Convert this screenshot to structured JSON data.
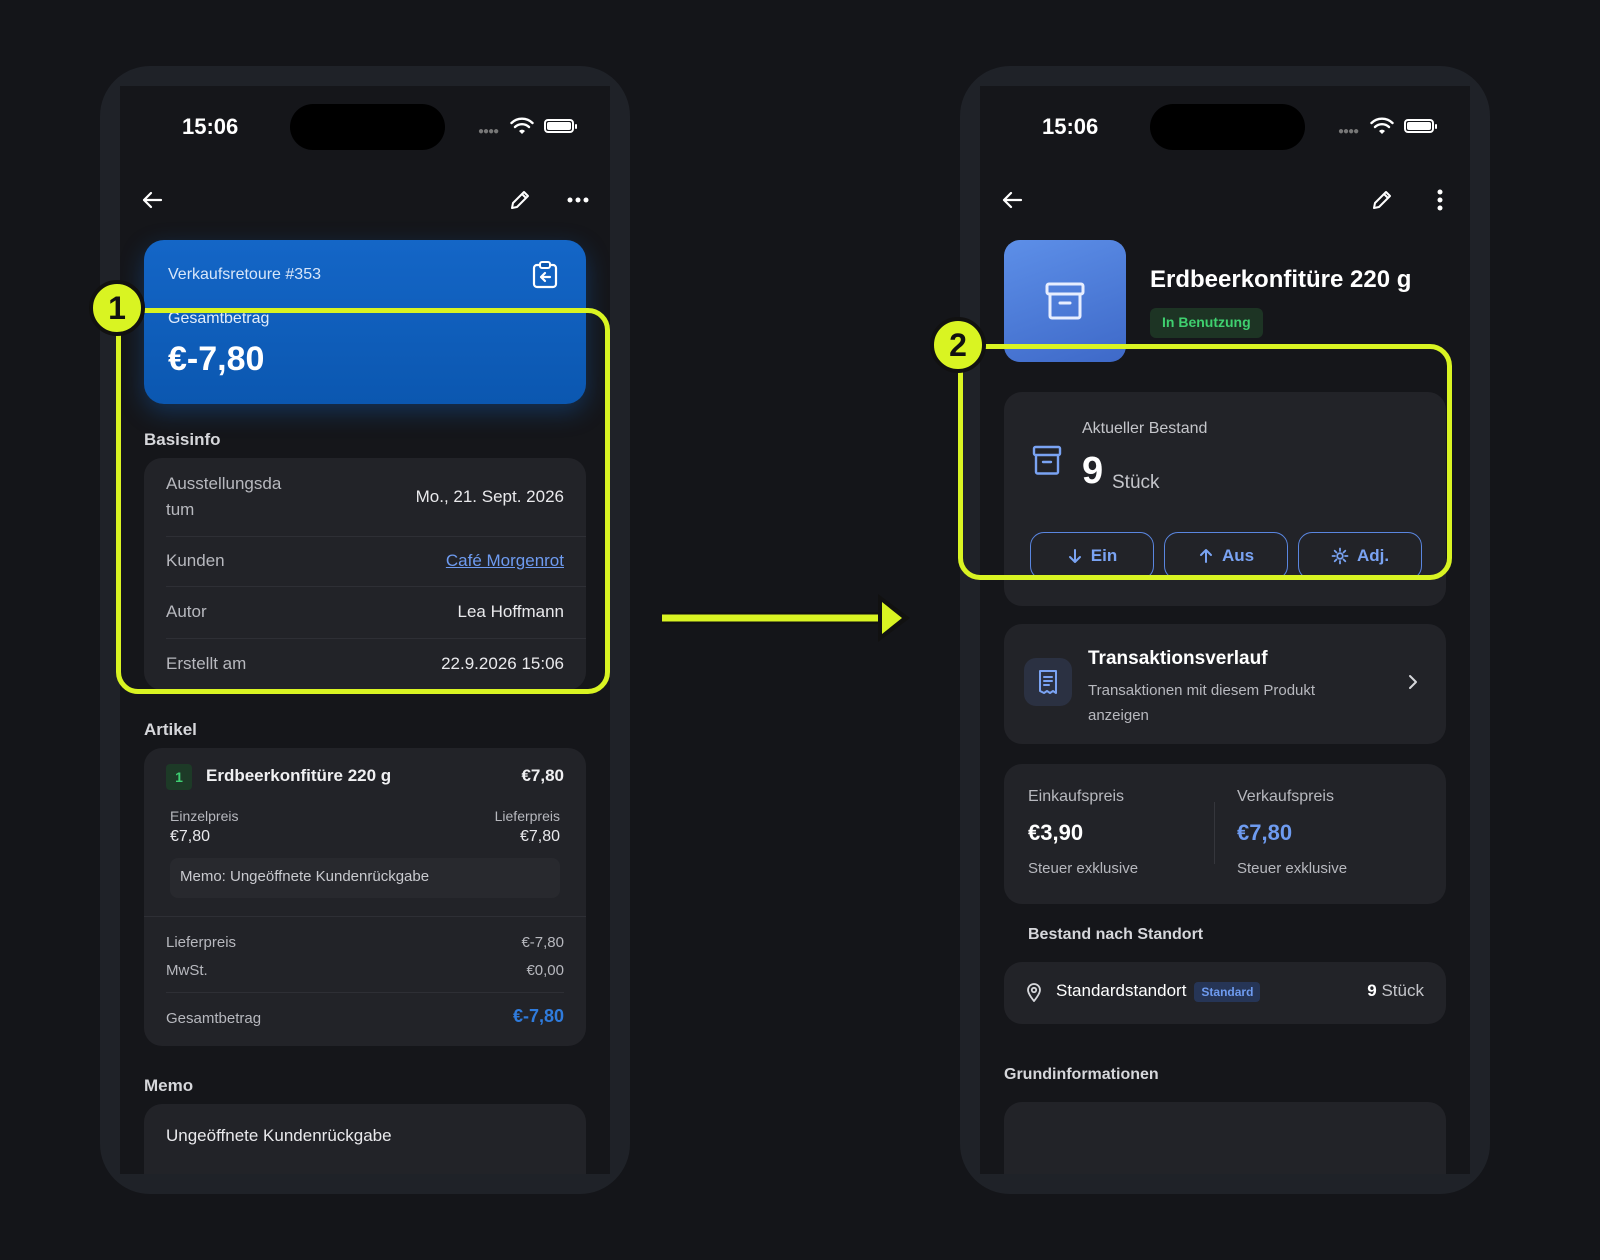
{
  "status_bar": {
    "time": "15:06"
  },
  "left_screen": {
    "hero": {
      "title": "Verkaufsretoure #353",
      "label": "Gesamtbetrag",
      "amount": "€-7,80"
    },
    "basisinfo": {
      "title": "Basisinfo",
      "rows": [
        {
          "key_line1": "Ausstellungsda",
          "key_line2": "tum",
          "value": "Mo., 21. Sept. 2026"
        },
        {
          "key": "Kunden",
          "value": "Café Morgenrot"
        },
        {
          "key": "Autor",
          "value": "Lea Hoffmann"
        },
        {
          "key": "Erstellt am",
          "value": "22.9.2026 15:06"
        }
      ]
    },
    "artikel": {
      "title": "Artikel",
      "item": {
        "number": "1",
        "name": "Erdbeerkonfitüre 220 g",
        "price": "€7,80",
        "unit_label": "Einzelpreis",
        "unit_value": "€7,80",
        "delivery_label": "Lieferpreis",
        "delivery_value": "€7,80",
        "memo": "Memo: Ungeöffnete Kundenrückgabe"
      },
      "summary": {
        "lieferpreis_label": "Lieferpreis",
        "lieferpreis_value": "€-7,80",
        "mwst_label": "MwSt.",
        "mwst_value": "€0,00",
        "total_label": "Gesamtbetrag",
        "total_value": "€-7,80"
      }
    },
    "memo": {
      "title": "Memo",
      "text": "Ungeöffnete Kundenrückgabe"
    }
  },
  "right_screen": {
    "product": {
      "name": "Erdbeerkonfitüre 220 g",
      "status": "In Benutzung"
    },
    "stock": {
      "label": "Aktueller Bestand",
      "quantity": "9",
      "unit": "Stück",
      "buttons": {
        "in": "Ein",
        "out": "Aus",
        "adjust": "Adj."
      }
    },
    "transactions": {
      "title": "Transaktionsverlauf",
      "subtitle_line1": "Transaktionen mit diesem Produkt",
      "subtitle_line2": "anzeigen"
    },
    "prices": {
      "purchase_label": "Einkaufspreis",
      "purchase_value": "€3,90",
      "purchase_note": "Steuer exklusive",
      "sale_label": "Verkaufspreis",
      "sale_value": "€7,80",
      "sale_note": "Steuer exklusive"
    },
    "locations": {
      "title": "Bestand nach Standort",
      "name": "Standardstandort",
      "badge": "Standard",
      "quantity": "9",
      "unit": "Stück"
    },
    "basic_info_title": "Grundinformationen"
  },
  "annotations": {
    "callout_1": "1",
    "callout_2": "2"
  },
  "colors": {
    "highlight": "#d9f422",
    "accent": "#1466c7",
    "link": "#6e9bf0",
    "success": "#3fd06f"
  }
}
